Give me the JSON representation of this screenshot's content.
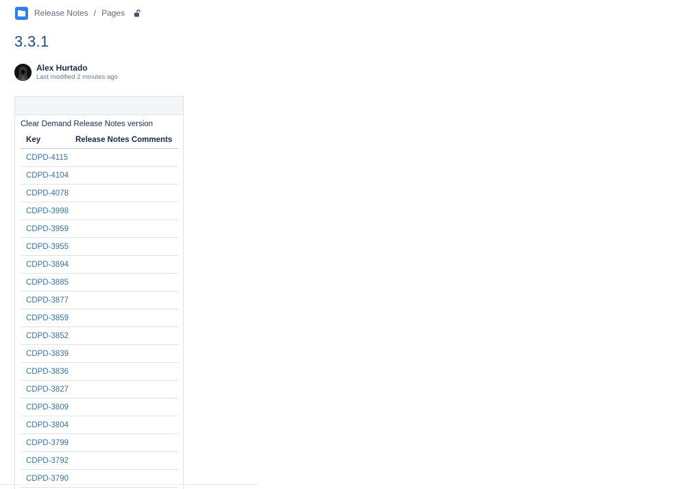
{
  "breadcrumb": {
    "space": "Release Notes",
    "separator": "/",
    "section": "Pages"
  },
  "page": {
    "title": "3.3.1"
  },
  "byline": {
    "author": "Alex Hurtado",
    "last_modified": "Last modified 2 minutes ago"
  },
  "panel": {
    "caption": "Clear Demand Release Notes version",
    "columns": [
      "Key",
      "Release Notes Comments"
    ],
    "rows": [
      {
        "key": "CDPD-4115",
        "comment": ""
      },
      {
        "key": "CDPD-4104",
        "comment": ""
      },
      {
        "key": "CDPD-4078",
        "comment": ""
      },
      {
        "key": "CDPD-3998",
        "comment": ""
      },
      {
        "key": "CDPD-3959",
        "comment": ""
      },
      {
        "key": "CDPD-3955",
        "comment": ""
      },
      {
        "key": "CDPD-3894",
        "comment": ""
      },
      {
        "key": "CDPD-3885",
        "comment": ""
      },
      {
        "key": "CDPD-3877",
        "comment": ""
      },
      {
        "key": "CDPD-3859",
        "comment": ""
      },
      {
        "key": "CDPD-3852",
        "comment": ""
      },
      {
        "key": "CDPD-3839",
        "comment": ""
      },
      {
        "key": "CDPD-3836",
        "comment": ""
      },
      {
        "key": "CDPD-3827",
        "comment": ""
      },
      {
        "key": "CDPD-3809",
        "comment": ""
      },
      {
        "key": "CDPD-3804",
        "comment": ""
      },
      {
        "key": "CDPD-3799",
        "comment": ""
      },
      {
        "key": "CDPD-3792",
        "comment": ""
      },
      {
        "key": "CDPD-3790",
        "comment": ""
      }
    ]
  },
  "icons": {
    "space": "space-icon",
    "restrictions": "unlock-icon",
    "avatar": "avatar"
  },
  "colors": {
    "link": "#3572b0",
    "title": "#1f4e79",
    "space_icon": "#2f80ed"
  }
}
